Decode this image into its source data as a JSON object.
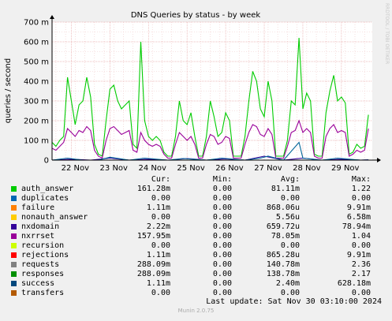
{
  "chart_data": {
    "type": "line",
    "title": "DNS Queries by status - by week",
    "ylabel": "queries / second",
    "ylim": [
      0,
      0.7
    ],
    "y_ticks": [
      {
        "value": 0,
        "label": "0"
      },
      {
        "value": 0.1,
        "label": "100 m"
      },
      {
        "value": 0.2,
        "label": "200 m"
      },
      {
        "value": 0.3,
        "label": "300 m"
      },
      {
        "value": 0.4,
        "label": "400 m"
      },
      {
        "value": 0.5,
        "label": "500 m"
      },
      {
        "value": 0.6,
        "label": "600 m"
      },
      {
        "value": 0.7,
        "label": "700 m"
      }
    ],
    "xlim": [
      0,
      8.3
    ],
    "x_ticks": [
      {
        "value": 0.6,
        "label": "22 Nov"
      },
      {
        "value": 1.6,
        "label": "23 Nov"
      },
      {
        "value": 2.6,
        "label": "24 Nov"
      },
      {
        "value": 3.6,
        "label": "25 Nov"
      },
      {
        "value": 4.6,
        "label": "26 Nov"
      },
      {
        "value": 5.6,
        "label": "27 Nov"
      },
      {
        "value": 6.6,
        "label": "28 Nov"
      },
      {
        "value": 7.6,
        "label": "29 Nov"
      }
    ],
    "grid": true,
    "series": [
      {
        "name": "auth_answer",
        "color": "#00cc00",
        "points": [
          [
            0.0,
            0.09
          ],
          [
            0.1,
            0.07
          ],
          [
            0.2,
            0.1
          ],
          [
            0.3,
            0.12
          ],
          [
            0.4,
            0.42
          ],
          [
            0.5,
            0.3
          ],
          [
            0.6,
            0.18
          ],
          [
            0.7,
            0.28
          ],
          [
            0.8,
            0.3
          ],
          [
            0.9,
            0.42
          ],
          [
            1.0,
            0.32
          ],
          [
            1.1,
            0.08
          ],
          [
            1.2,
            0.03
          ],
          [
            1.3,
            0.02
          ],
          [
            1.4,
            0.2
          ],
          [
            1.5,
            0.36
          ],
          [
            1.6,
            0.38
          ],
          [
            1.7,
            0.3
          ],
          [
            1.8,
            0.26
          ],
          [
            1.9,
            0.28
          ],
          [
            2.0,
            0.3
          ],
          [
            2.1,
            0.08
          ],
          [
            2.2,
            0.06
          ],
          [
            2.3,
            0.6
          ],
          [
            2.4,
            0.2
          ],
          [
            2.5,
            0.12
          ],
          [
            2.6,
            0.1
          ],
          [
            2.7,
            0.12
          ],
          [
            2.8,
            0.1
          ],
          [
            2.9,
            0.04
          ],
          [
            3.0,
            0.02
          ],
          [
            3.1,
            0.02
          ],
          [
            3.2,
            0.12
          ],
          [
            3.3,
            0.3
          ],
          [
            3.4,
            0.2
          ],
          [
            3.5,
            0.18
          ],
          [
            3.6,
            0.24
          ],
          [
            3.7,
            0.12
          ],
          [
            3.8,
            0.02
          ],
          [
            3.9,
            0.02
          ],
          [
            4.0,
            0.12
          ],
          [
            4.1,
            0.3
          ],
          [
            4.2,
            0.22
          ],
          [
            4.3,
            0.12
          ],
          [
            4.4,
            0.14
          ],
          [
            4.5,
            0.24
          ],
          [
            4.6,
            0.2
          ],
          [
            4.7,
            0.02
          ],
          [
            4.8,
            0.02
          ],
          [
            4.9,
            0.02
          ],
          [
            5.0,
            0.12
          ],
          [
            5.1,
            0.3
          ],
          [
            5.2,
            0.45
          ],
          [
            5.3,
            0.4
          ],
          [
            5.4,
            0.26
          ],
          [
            5.5,
            0.22
          ],
          [
            5.6,
            0.4
          ],
          [
            5.7,
            0.3
          ],
          [
            5.8,
            0.02
          ],
          [
            5.9,
            0.02
          ],
          [
            6.0,
            0.02
          ],
          [
            6.1,
            0.1
          ],
          [
            6.2,
            0.3
          ],
          [
            6.3,
            0.28
          ],
          [
            6.4,
            0.62
          ],
          [
            6.5,
            0.26
          ],
          [
            6.6,
            0.34
          ],
          [
            6.7,
            0.3
          ],
          [
            6.8,
            0.03
          ],
          [
            6.9,
            0.02
          ],
          [
            7.0,
            0.02
          ],
          [
            7.1,
            0.24
          ],
          [
            7.2,
            0.35
          ],
          [
            7.3,
            0.43
          ],
          [
            7.4,
            0.3
          ],
          [
            7.5,
            0.32
          ],
          [
            7.6,
            0.29
          ],
          [
            7.7,
            0.03
          ],
          [
            7.8,
            0.04
          ],
          [
            7.9,
            0.08
          ],
          [
            8.0,
            0.06
          ],
          [
            8.1,
            0.07
          ],
          [
            8.2,
            0.23
          ]
        ]
      },
      {
        "name": "nxrrset",
        "color": "#990099",
        "points": [
          [
            0.0,
            0.06
          ],
          [
            0.1,
            0.05
          ],
          [
            0.2,
            0.07
          ],
          [
            0.3,
            0.09
          ],
          [
            0.4,
            0.16
          ],
          [
            0.5,
            0.14
          ],
          [
            0.6,
            0.12
          ],
          [
            0.7,
            0.15
          ],
          [
            0.8,
            0.14
          ],
          [
            0.9,
            0.17
          ],
          [
            1.0,
            0.15
          ],
          [
            1.1,
            0.05
          ],
          [
            1.2,
            0.02
          ],
          [
            1.3,
            0.01
          ],
          [
            1.4,
            0.1
          ],
          [
            1.5,
            0.16
          ],
          [
            1.6,
            0.17
          ],
          [
            1.7,
            0.15
          ],
          [
            1.8,
            0.13
          ],
          [
            1.9,
            0.14
          ],
          [
            2.0,
            0.15
          ],
          [
            2.1,
            0.05
          ],
          [
            2.2,
            0.04
          ],
          [
            2.3,
            0.14
          ],
          [
            2.4,
            0.1
          ],
          [
            2.5,
            0.08
          ],
          [
            2.6,
            0.07
          ],
          [
            2.7,
            0.08
          ],
          [
            2.8,
            0.07
          ],
          [
            2.9,
            0.03
          ],
          [
            3.0,
            0.01
          ],
          [
            3.1,
            0.01
          ],
          [
            3.2,
            0.08
          ],
          [
            3.3,
            0.14
          ],
          [
            3.4,
            0.12
          ],
          [
            3.5,
            0.1
          ],
          [
            3.6,
            0.12
          ],
          [
            3.7,
            0.08
          ],
          [
            3.8,
            0.01
          ],
          [
            3.9,
            0.01
          ],
          [
            4.0,
            0.08
          ],
          [
            4.1,
            0.13
          ],
          [
            4.2,
            0.12
          ],
          [
            4.3,
            0.08
          ],
          [
            4.4,
            0.09
          ],
          [
            4.5,
            0.12
          ],
          [
            4.6,
            0.11
          ],
          [
            4.7,
            0.01
          ],
          [
            4.8,
            0.01
          ],
          [
            4.9,
            0.01
          ],
          [
            5.0,
            0.08
          ],
          [
            5.1,
            0.14
          ],
          [
            5.2,
            0.18
          ],
          [
            5.3,
            0.17
          ],
          [
            5.4,
            0.13
          ],
          [
            5.5,
            0.12
          ],
          [
            5.6,
            0.16
          ],
          [
            5.7,
            0.13
          ],
          [
            5.8,
            0.01
          ],
          [
            5.9,
            0.01
          ],
          [
            6.0,
            0.01
          ],
          [
            6.1,
            0.07
          ],
          [
            6.2,
            0.14
          ],
          [
            6.3,
            0.15
          ],
          [
            6.4,
            0.2
          ],
          [
            6.5,
            0.14
          ],
          [
            6.6,
            0.16
          ],
          [
            6.7,
            0.14
          ],
          [
            6.8,
            0.02
          ],
          [
            6.9,
            0.01
          ],
          [
            7.0,
            0.01
          ],
          [
            7.1,
            0.12
          ],
          [
            7.2,
            0.16
          ],
          [
            7.3,
            0.18
          ],
          [
            7.4,
            0.14
          ],
          [
            7.5,
            0.15
          ],
          [
            7.6,
            0.14
          ],
          [
            7.7,
            0.02
          ],
          [
            7.8,
            0.03
          ],
          [
            7.9,
            0.05
          ],
          [
            8.0,
            0.04
          ],
          [
            8.1,
            0.05
          ],
          [
            8.2,
            0.16
          ]
        ]
      },
      {
        "name": "nxdomain",
        "color": "#330099",
        "points": [
          [
            0.0,
            0.0
          ],
          [
            0.5,
            0.005
          ],
          [
            1.0,
            0.0
          ],
          [
            1.5,
            0.01
          ],
          [
            2.0,
            0.0
          ],
          [
            2.5,
            0.005
          ],
          [
            3.0,
            0.0
          ],
          [
            3.5,
            0.008
          ],
          [
            4.0,
            0.0
          ],
          [
            4.5,
            0.006
          ],
          [
            5.0,
            0.0
          ],
          [
            5.5,
            0.02
          ],
          [
            6.0,
            0.0
          ],
          [
            6.5,
            0.01
          ],
          [
            7.0,
            0.0
          ],
          [
            7.5,
            0.005
          ],
          [
            8.0,
            0.0
          ],
          [
            8.2,
            0.002
          ]
        ]
      },
      {
        "name": "success",
        "color": "#006699",
        "points": [
          [
            0.0,
            0.0
          ],
          [
            0.4,
            0.01
          ],
          [
            0.8,
            0.0
          ],
          [
            1.2,
            0.0
          ],
          [
            1.5,
            0.015
          ],
          [
            2.0,
            0.0
          ],
          [
            2.4,
            0.01
          ],
          [
            3.0,
            0.0
          ],
          [
            3.4,
            0.008
          ],
          [
            4.0,
            0.0
          ],
          [
            4.4,
            0.01
          ],
          [
            5.0,
            0.0
          ],
          [
            5.4,
            0.01
          ],
          [
            5.6,
            0.02
          ],
          [
            6.0,
            0.0
          ],
          [
            6.4,
            0.09
          ],
          [
            6.5,
            0.01
          ],
          [
            7.0,
            0.0
          ],
          [
            7.4,
            0.01
          ],
          [
            8.0,
            0.0
          ],
          [
            8.2,
            0.001
          ]
        ]
      }
    ]
  },
  "legend": {
    "headers": {
      "cur": "Cur:",
      "min": "Min:",
      "avg": "Avg:",
      "max": "Max:"
    },
    "rows": [
      {
        "name": "auth_answer",
        "color": "#00cc00",
        "cur": "161.28m",
        "min": "0.00",
        "avg": "81.11m",
        "max": "1.22"
      },
      {
        "name": "duplicates",
        "color": "#0066b3",
        "cur": "0.00",
        "min": "0.00",
        "avg": "0.00",
        "max": "0.00"
      },
      {
        "name": "failure",
        "color": "#ff8000",
        "cur": "1.11m",
        "min": "0.00",
        "avg": "868.06u",
        "max": "9.91m"
      },
      {
        "name": "nonauth_answer",
        "color": "#ffcc00",
        "cur": "0.00",
        "min": "0.00",
        "avg": "5.56u",
        "max": "6.58m"
      },
      {
        "name": "nxdomain",
        "color": "#330099",
        "cur": "2.22m",
        "min": "0.00",
        "avg": "659.72u",
        "max": "78.94m"
      },
      {
        "name": "nxrrset",
        "color": "#990099",
        "cur": "157.95m",
        "min": "0.00",
        "avg": "78.05m",
        "max": "1.04"
      },
      {
        "name": "recursion",
        "color": "#ccff00",
        "cur": "0.00",
        "min": "0.00",
        "avg": "0.00",
        "max": "0.00"
      },
      {
        "name": "rejections",
        "color": "#ff0000",
        "cur": "1.11m",
        "min": "0.00",
        "avg": "865.28u",
        "max": "9.91m"
      },
      {
        "name": "requests",
        "color": "#808080",
        "cur": "288.09m",
        "min": "0.00",
        "avg": "140.78m",
        "max": "2.36"
      },
      {
        "name": "responses",
        "color": "#008f00",
        "cur": "288.09m",
        "min": "0.00",
        "avg": "138.78m",
        "max": "2.17"
      },
      {
        "name": "success",
        "color": "#00487d",
        "cur": "1.11m",
        "min": "0.00",
        "avg": "2.40m",
        "max": "628.18m"
      },
      {
        "name": "transfers",
        "color": "#b35a00",
        "cur": "0.00",
        "min": "0.00",
        "avg": "0.00",
        "max": "0.00"
      }
    ]
  },
  "footer": {
    "last_update": "Last update: Sat Nov 30 03:10:00 2024",
    "munin_version": "Munin 2.0.75"
  },
  "side_label": "RRDTOOL / TOBI OETIKER"
}
